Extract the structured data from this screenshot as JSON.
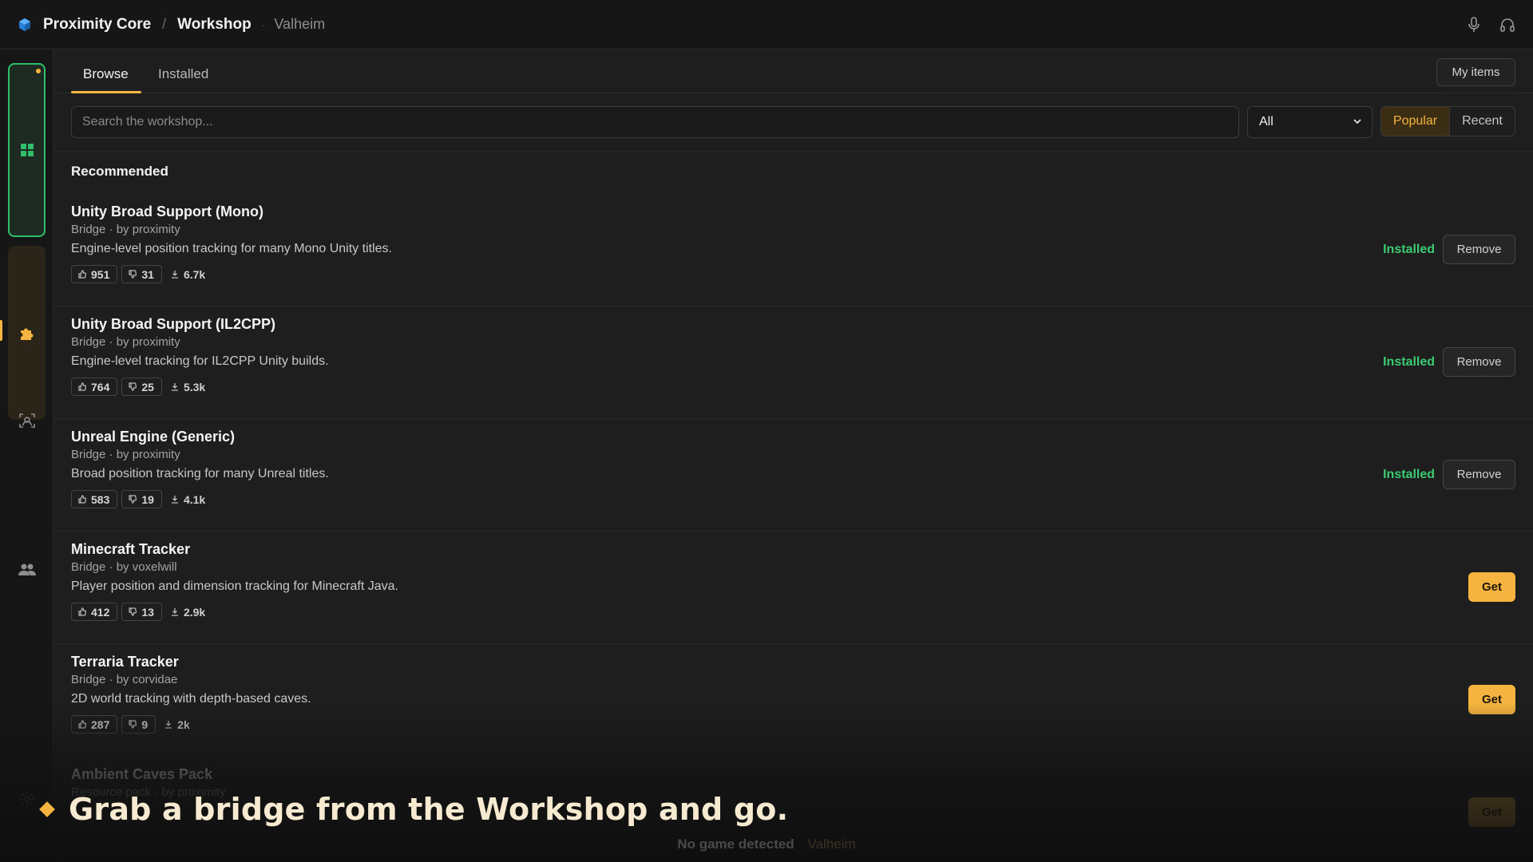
{
  "header": {
    "app_name": "Proximity Core",
    "separator": "/",
    "page": "Workshop",
    "dot": "·",
    "game": "Valheim"
  },
  "tabs": {
    "browse": "Browse",
    "installed": "Installed",
    "my_items": "My items"
  },
  "toolbar": {
    "search_placeholder": "Search the workshop...",
    "filter_value": "All",
    "sort_popular": "Popular",
    "sort_recent": "Recent"
  },
  "section_title": "Recommended",
  "items": [
    {
      "title": "Unity Broad Support (Mono)",
      "meta": "Bridge · by proximity",
      "desc": "Engine-level position tracking for many Mono Unity titles.",
      "up": "951",
      "down": "31",
      "downloads": "6.7k",
      "status": "Installed",
      "action": "Remove"
    },
    {
      "title": "Unity Broad Support (IL2CPP)",
      "meta": "Bridge · by proximity",
      "desc": "Engine-level tracking for IL2CPP Unity builds.",
      "up": "764",
      "down": "25",
      "downloads": "5.3k",
      "status": "Installed",
      "action": "Remove"
    },
    {
      "title": "Unreal Engine (Generic)",
      "meta": "Bridge · by proximity",
      "desc": "Broad position tracking for many Unreal titles.",
      "up": "583",
      "down": "19",
      "downloads": "4.1k",
      "status": "Installed",
      "action": "Remove"
    },
    {
      "title": "Minecraft Tracker",
      "meta": "Bridge · by voxelwill",
      "desc": "Player position and dimension tracking for Minecraft Java.",
      "up": "412",
      "down": "13",
      "downloads": "2.9k",
      "status": "",
      "action": "Get"
    },
    {
      "title": "Terraria Tracker",
      "meta": "Bridge · by corvidae",
      "desc": "2D world tracking with depth-based caves.",
      "up": "287",
      "down": "9",
      "downloads": "2k",
      "status": "",
      "action": "Get"
    },
    {
      "title": "Ambient Caves Pack",
      "meta": "Resource pack · by proximity",
      "desc": "",
      "up": "",
      "down": "",
      "downloads": "",
      "status": "",
      "action": "Get"
    }
  ],
  "status_bar": {
    "text": "No game detected",
    "game": "Valheim"
  },
  "caption": "Grab a bridge from the Workshop and go.",
  "colors": {
    "accent": "#f5b43f",
    "installed_green": "#3ccb73",
    "rail_green": "#2fbf6a"
  },
  "icons": [
    "app-logo-cube-icon",
    "microphone-icon",
    "headphones-icon",
    "grid-icon",
    "puzzle-icon",
    "scan-face-icon",
    "users-icon",
    "gear-icon",
    "thumb-up-icon",
    "thumb-down-icon",
    "download-icon",
    "chevron-down-icon"
  ]
}
